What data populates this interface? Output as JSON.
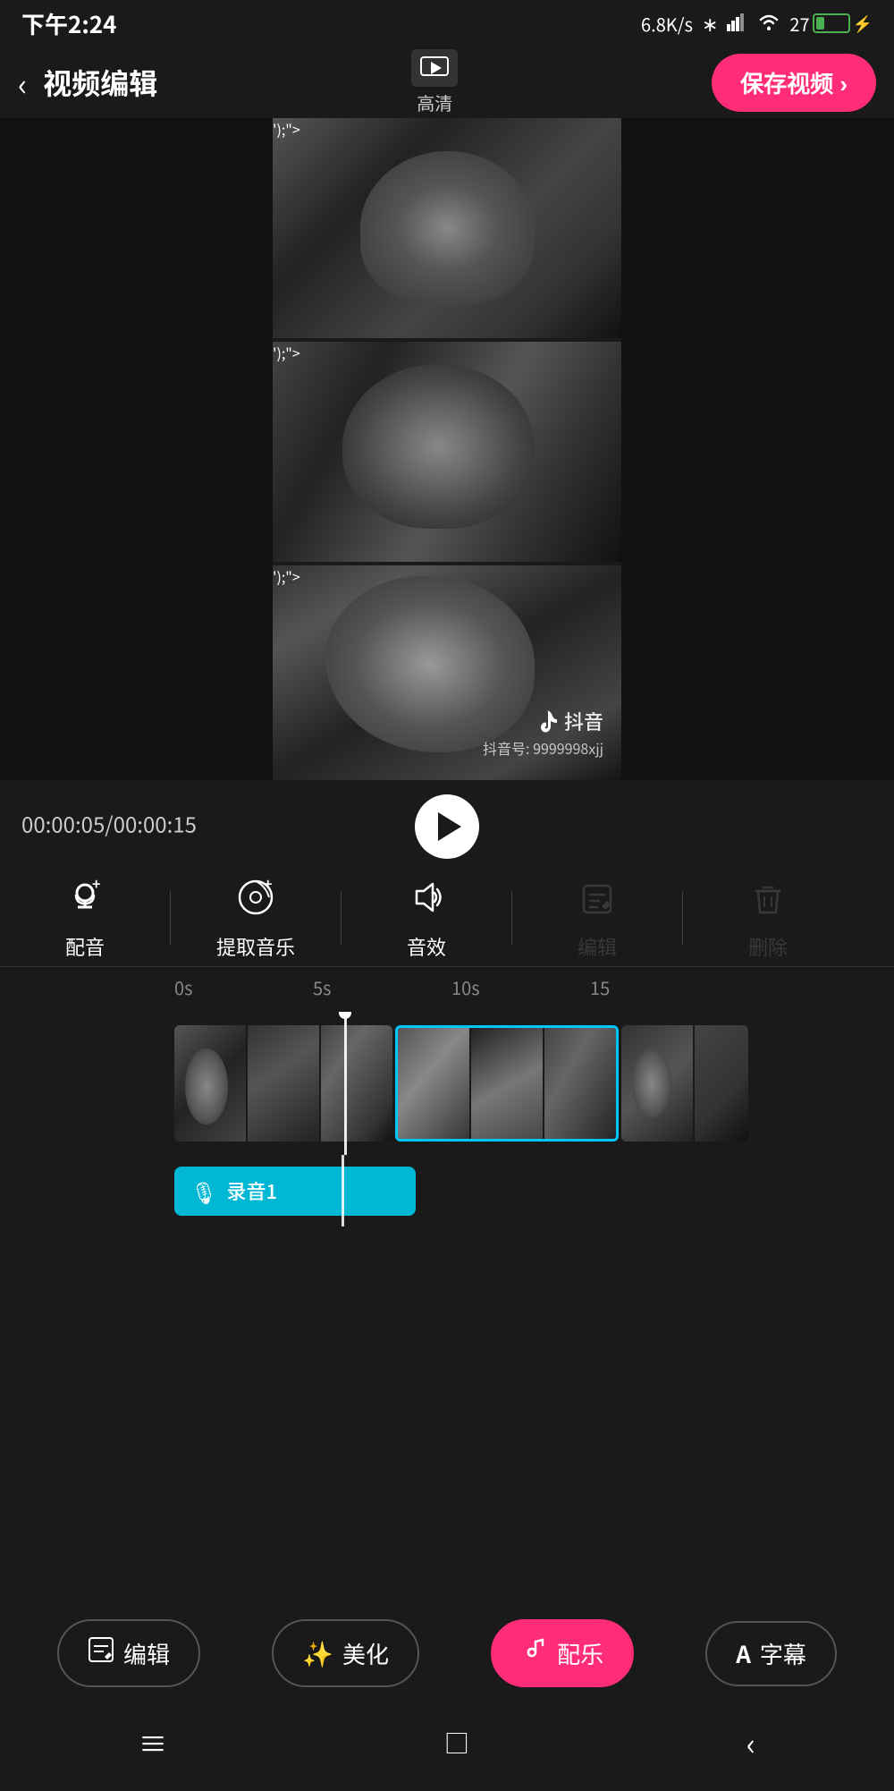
{
  "statusBar": {
    "time": "下午2:24",
    "network": "6.8K/s",
    "bluetooth": "bluetooth",
    "signal": "signal",
    "wifi": "wifi",
    "battery": "27"
  },
  "header": {
    "backLabel": "‹",
    "title": "视频编辑",
    "hdLabel": "高清",
    "saveLabel": "保存视频 ›"
  },
  "watermark": {
    "appName": "抖音",
    "accountId": "抖音号: 9999998xjj"
  },
  "timecode": {
    "current": "00:00:05",
    "total": "00:00:15",
    "display": "00:00:05/00:00:15"
  },
  "tools": [
    {
      "icon": "🎙",
      "label": "配音",
      "hasPlus": true,
      "disabled": false
    },
    {
      "icon": "🎵",
      "label": "提取音乐",
      "hasPlus": true,
      "disabled": false
    },
    {
      "icon": "🎼",
      "label": "音效",
      "hasPlus": false,
      "disabled": false
    },
    {
      "icon": "✏️",
      "label": "编辑",
      "hasPlus": false,
      "disabled": true
    },
    {
      "icon": "🗑",
      "label": "删除",
      "hasPlus": false,
      "disabled": true
    }
  ],
  "ruler": {
    "labels": [
      "0s",
      "5s",
      "10s",
      "15"
    ]
  },
  "audioTrack": {
    "micIcon": "🎙",
    "label": "录音1"
  },
  "bottomNav": [
    {
      "icon": "📋",
      "label": "编辑",
      "active": false
    },
    {
      "icon": "✨",
      "label": "美化",
      "active": false
    },
    {
      "icon": "🎵",
      "label": "配乐",
      "active": true
    },
    {
      "icon": "A",
      "label": "字幕",
      "active": false
    }
  ],
  "systemNav": {
    "menu": "≡",
    "home": "□",
    "back": "‹"
  }
}
